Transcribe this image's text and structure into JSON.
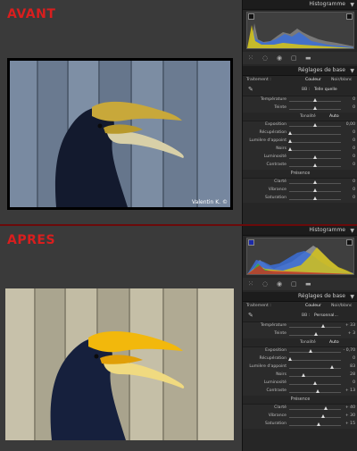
{
  "labels": {
    "before": "AVANT",
    "after": "APRES"
  },
  "credit": "Valentin K. ©",
  "panel": {
    "histogram_title": "Histogramme",
    "basic_title": "Réglages de base",
    "treatment": "Traitement :",
    "color": "Couleur",
    "bw": "Noir/blanc",
    "wb_label": "BB :",
    "tonality": "Tonalité",
    "auto": "Auto",
    "presence": "Présence"
  },
  "before": {
    "wb_value": "Telle quelle",
    "sliders": [
      {
        "label": "Température",
        "value": "0",
        "pos": 0.5
      },
      {
        "label": "Teinte",
        "value": "0",
        "pos": 0.5
      },
      {
        "label": "Exposition",
        "value": "0,00",
        "pos": 0.5
      },
      {
        "label": "Récupération",
        "value": "0",
        "pos": 0.02
      },
      {
        "label": "Lumière d'appoint",
        "value": "0",
        "pos": 0.02
      },
      {
        "label": "Noirs",
        "value": "0",
        "pos": 0.02
      },
      {
        "label": "Luminosité",
        "value": "0",
        "pos": 0.5
      },
      {
        "label": "Contraste",
        "value": "0",
        "pos": 0.5
      },
      {
        "label": "Clarté",
        "value": "0",
        "pos": 0.5
      },
      {
        "label": "Vibrance",
        "value": "0",
        "pos": 0.5
      },
      {
        "label": "Saturation",
        "value": "0",
        "pos": 0.5
      }
    ]
  },
  "after": {
    "wb_value": "Personnal...",
    "sliders": [
      {
        "label": "Température",
        "value": "+ 33",
        "pos": 0.66
      },
      {
        "label": "Teinte",
        "value": "+ 3",
        "pos": 0.52
      },
      {
        "label": "Exposition",
        "value": "- 0,70",
        "pos": 0.42
      },
      {
        "label": "Récupération",
        "value": "0",
        "pos": 0.02
      },
      {
        "label": "Lumière d'appoint",
        "value": "83",
        "pos": 0.83
      },
      {
        "label": "Noirs",
        "value": "28",
        "pos": 0.28
      },
      {
        "label": "Luminosité",
        "value": "0",
        "pos": 0.5
      },
      {
        "label": "Contraste",
        "value": "+ 13",
        "pos": 0.56
      },
      {
        "label": "Clarté",
        "value": "+ 40",
        "pos": 0.7
      },
      {
        "label": "Vibrance",
        "value": "+ 30",
        "pos": 0.65
      },
      {
        "label": "Saturation",
        "value": "+ 15",
        "pos": 0.57
      }
    ]
  },
  "colors": {
    "label_red": "#d91e1e",
    "panel_bg": "#262626"
  }
}
